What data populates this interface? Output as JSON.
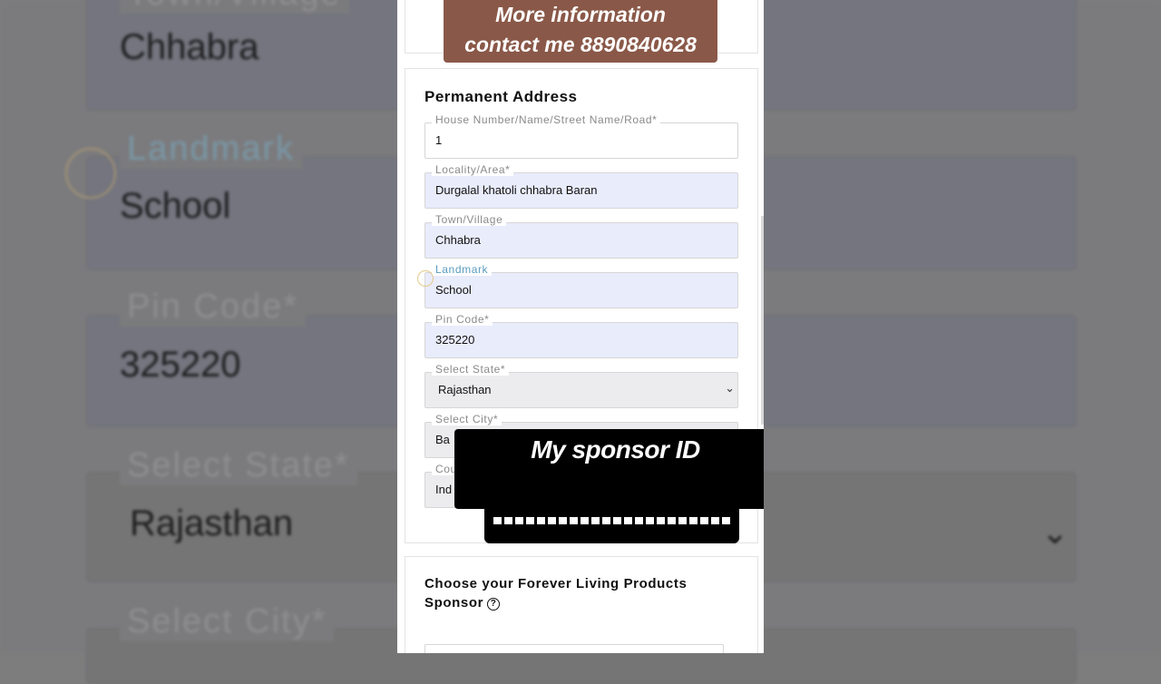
{
  "banner": {
    "line1": "More information",
    "line2": "contact me 8890840628"
  },
  "background": {
    "town_label": "Town/Village",
    "town_value": "Chhabra",
    "landmark_label": "Landmark",
    "landmark_value": "School",
    "pin_label": "Pin Code*",
    "pin_value": "325220",
    "state_label": "Select State*",
    "state_value": "Rajasthan",
    "city_label": "Select City*"
  },
  "form": {
    "section_title": "Permanent Address",
    "fields": [
      {
        "label": "House Number/Name/Street Name/Road*",
        "value": "1"
      },
      {
        "label": "Locality/Area*",
        "value": "Durgalal khatoli chhabra Baran"
      },
      {
        "label": "Town/Village",
        "value": "Chhabra"
      },
      {
        "label": "Landmark",
        "value": "School"
      },
      {
        "label": "Pin Code*",
        "value": "325220"
      },
      {
        "label": "Select State*",
        "value": "Rajasthan"
      },
      {
        "label": "Select City*",
        "value": "Ba"
      },
      {
        "label": "Cou",
        "value": "Ind"
      }
    ]
  },
  "sponsor": {
    "title": "Choose your Forever Living Products Sponsor",
    "help_icon": "?",
    "overlay_heading": "My sponsor ID"
  }
}
